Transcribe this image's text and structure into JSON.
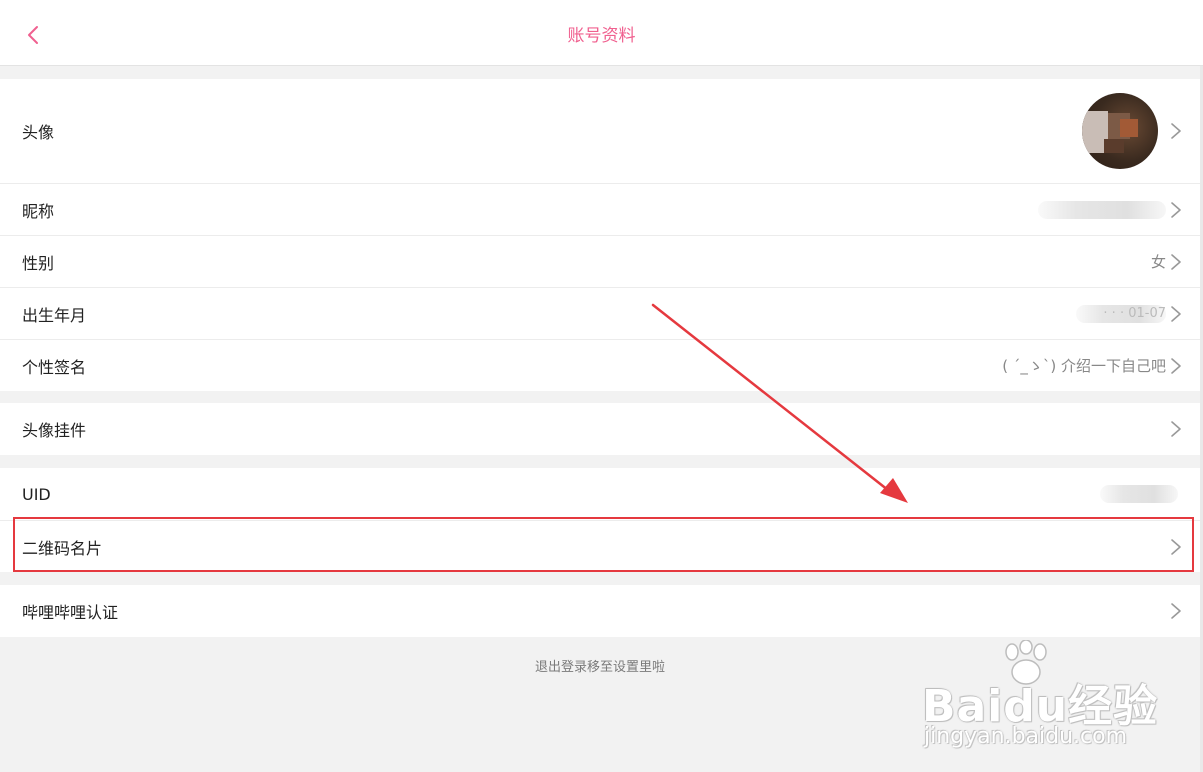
{
  "header": {
    "title": "账号资料"
  },
  "profile_group": {
    "avatar_label": "头像",
    "rows": [
      {
        "label": "昵称",
        "value": ""
      },
      {
        "label": "性别",
        "value": "女"
      },
      {
        "label": "出生年月",
        "value": "· · · 01-07"
      },
      {
        "label": "个性签名",
        "value": "( ´_ゝ`) 介绍一下自己吧"
      }
    ]
  },
  "pendant_group": {
    "label": "头像挂件"
  },
  "id_group": {
    "uid_label": "UID",
    "uid_value": "",
    "qr_label": "二维码名片"
  },
  "cert_group": {
    "label": "哔哩哔哩认证"
  },
  "footer": {
    "note": "退出登录移至设置里啦"
  },
  "watermark": {
    "brand": "Baidu经验",
    "url": "jingyan.baidu.com"
  },
  "colors": {
    "accent": "#f0608f",
    "highlight": "#e5393f",
    "background": "#f2f2f2"
  },
  "icons": {
    "back": "chevron-left-icon",
    "row_arrow": "chevron-right-icon"
  }
}
